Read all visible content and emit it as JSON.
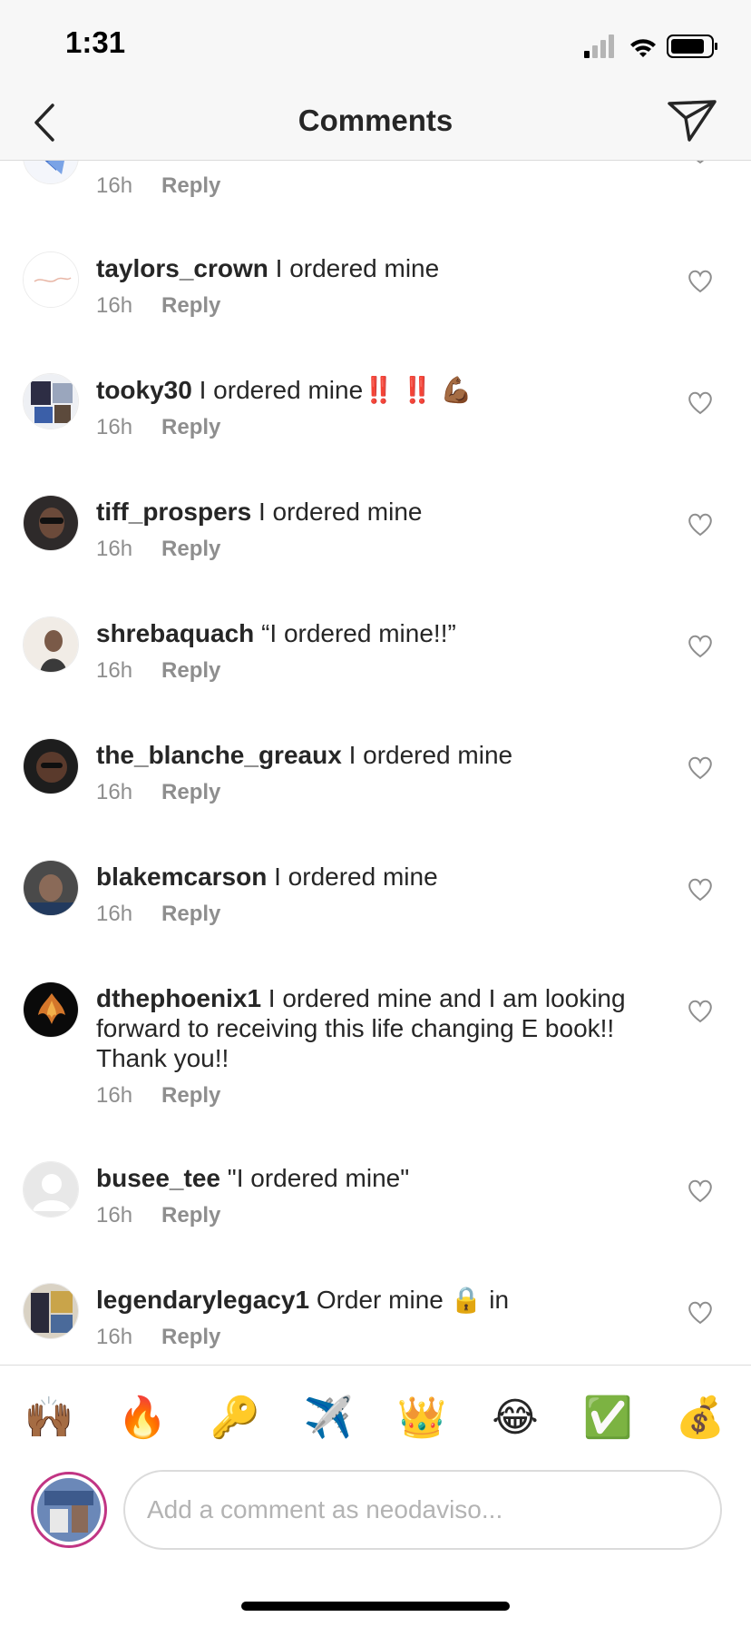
{
  "status_bar": {
    "time": "1:31",
    "icons": [
      "cellular-signal-icon",
      "wifi-icon",
      "battery-icon"
    ]
  },
  "nav": {
    "back_icon": "chevron-left-icon",
    "title": "Comments",
    "send_icon": "paper-plane-icon"
  },
  "comments": [
    {
      "username": "",
      "text": "",
      "time": "16h",
      "reply_label": "Reply"
    },
    {
      "username": "taylors_crown",
      "text": "I ordered mine",
      "time": "16h",
      "reply_label": "Reply"
    },
    {
      "username": "tooky30",
      "text": "I ordered mine",
      "emoji": "‼️ ‼️ 💪🏾",
      "time": "16h",
      "reply_label": "Reply"
    },
    {
      "username": "tiff_prospers",
      "text": "I ordered mine",
      "time": "16h",
      "reply_label": "Reply"
    },
    {
      "username": "shrebaquach",
      "text": "“I ordered mine!!”",
      "time": "16h",
      "reply_label": "Reply"
    },
    {
      "username": "the_blanche_greaux",
      "text": "I ordered mine",
      "time": "16h",
      "reply_label": "Reply"
    },
    {
      "username": "blakemcarson",
      "text": "I ordered mine",
      "time": "16h",
      "reply_label": "Reply"
    },
    {
      "username": "dthephoenix1",
      "text": "I ordered mine and I am looking forward to receiving this life changing E book!! Thank you!!",
      "time": "16h",
      "reply_label": "Reply"
    },
    {
      "username": "busee_tee",
      "text": "\"I ordered mine\"",
      "time": "16h",
      "reply_label": "Reply"
    },
    {
      "username": "legendarylegacy1",
      "text": "Order mine",
      "emoji": "🔒",
      "text_after": "in",
      "time": "16h",
      "reply_label": "Reply"
    }
  ],
  "quick_emojis": [
    "🙌🏾",
    "🔥",
    "🔑",
    "✈️",
    "👑",
    "😂",
    "✅",
    "💰"
  ],
  "composer": {
    "placeholder": "Add a comment as neodaviso..."
  },
  "colors": {
    "text": "#262626",
    "muted": "#8e8e8e",
    "divider": "#dbdbdb",
    "story_ring": "#c13584"
  }
}
